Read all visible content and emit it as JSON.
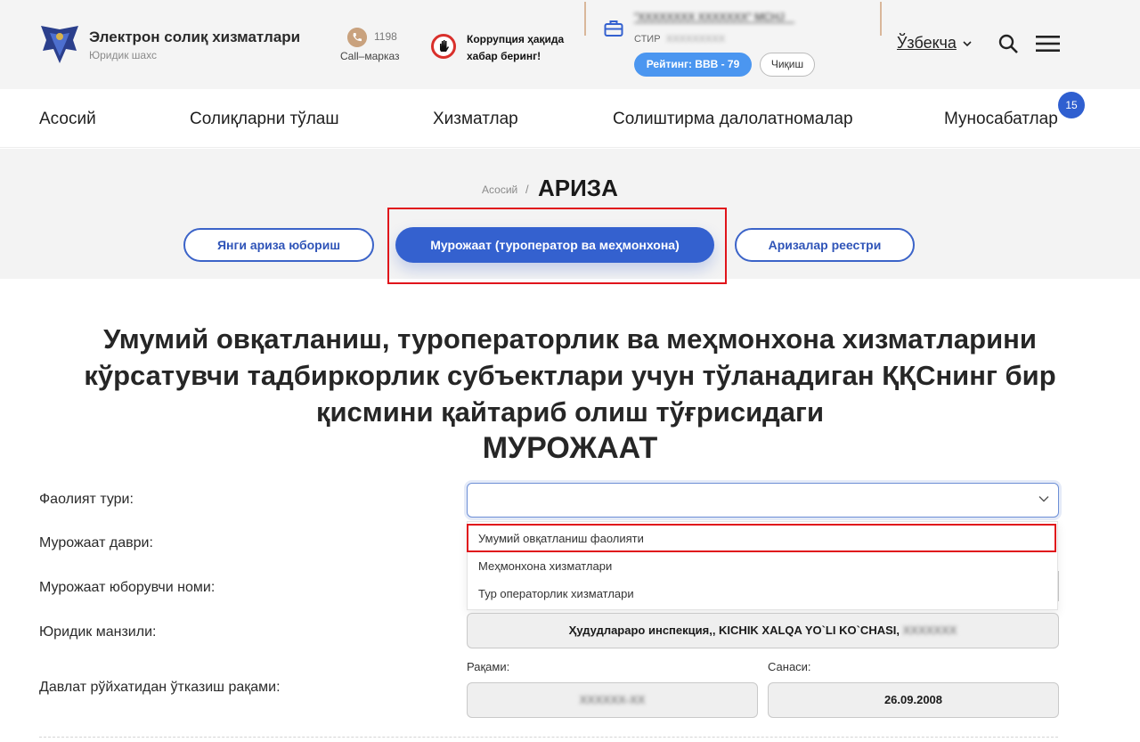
{
  "header": {
    "brand_title": "Электрон солиқ хизматлари",
    "brand_subtitle": "Юридик шахс",
    "phone_number": "1198",
    "phone_label": "Call–марказ",
    "corruption_text": "Коррупция ҳақида хабар беринг!",
    "company_name": "\"XXXXXXXX XXXXXXX\" MCHJ",
    "stir_label": "СТИР",
    "stir_value": "XXXXXXXXX",
    "rating_label": "Рейтинг: BBB - 79",
    "exit_label": "Чиқиш",
    "language": "Ўзбекча"
  },
  "nav": {
    "items": [
      "Асосий",
      "Солиқларни тўлаш",
      "Хизматлар",
      "Солиштирма далолатномалар",
      "Муносабатлар"
    ],
    "badge_count": "15"
  },
  "breadcrumb": {
    "home": "Асосий",
    "separator": "/",
    "current": "АРИЗА"
  },
  "tabs": {
    "new_application": "Янги ариза юбориш",
    "appeal": "Мурожаат (туроператор ва меҳмонхона)",
    "registry": "Аризалар реестри"
  },
  "page": {
    "heading_lines": [
      "Умумий овқатланиш, туроператорлик ва меҳмонхона хизматларини",
      "кўрсатувчи тадбиркорлик субъектлари учун тўланадиган ҚҚСнинг бир",
      "қисмини қайтариб олиш тўғрисидаги"
    ],
    "subheading": "МУРОЖААТ"
  },
  "form": {
    "activity_type_label": "Фаолият тури:",
    "activity_type_value": "",
    "activity_options": [
      "Умумий овқатланиш фаолияти",
      "Меҳмонхона хизматлари",
      "Тур операторлик хизматлари"
    ],
    "period_label": "Мурожаат даври:",
    "sender_label": "Мурожаат юборувчи номи:",
    "address_label": "Юридик манзили:",
    "address_value": "Ҳудудлараро инспекция,, KICHIK XALQA YO`LI KO`CHASI,",
    "address_hidden": "XXXXXXX",
    "registration_label": "Давлат рўйхатидан ўтказиш рақами:",
    "number_label": "Рақами:",
    "number_value": "XXXXXX-XX",
    "date_label": "Санаси:",
    "date_value": "26.09.2008"
  },
  "colors": {
    "accent": "#3461cf",
    "rating": "#4b96f0",
    "highlight": "#e0141b"
  }
}
